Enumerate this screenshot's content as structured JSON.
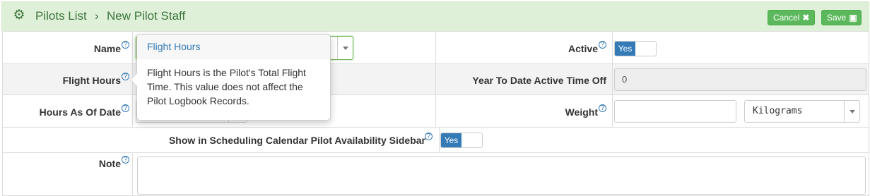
{
  "header": {
    "breadcrumb_link": "Pilots List",
    "separator": "›",
    "current": "New Pilot Staff",
    "cancel_label": "Cancel",
    "save_label": "Save",
    "icons": {
      "header": "gear-icon",
      "cancel": "close-icon",
      "save": "floppy-disk-icon"
    },
    "background_color": "#dff0d8",
    "text_color": "#3c763d"
  },
  "form": {
    "name": {
      "label": "Name",
      "value": ""
    },
    "active": {
      "label": "Active",
      "value": "Yes"
    },
    "flight_hours": {
      "label": "Flight Hours"
    },
    "ytd_time_off": {
      "label": "Year To Date Active Time Off",
      "value": "0"
    },
    "hours_as_of_date": {
      "label": "Hours As Of Date"
    },
    "weight": {
      "label": "Weight",
      "value": "",
      "unit": "Kilograms"
    },
    "show_in_calendar": {
      "label": "Show in Scheduling Calendar Pilot Availability Sidebar",
      "value": "Yes"
    },
    "note": {
      "label": "Note",
      "value": ""
    },
    "help_glyph": "?"
  },
  "popover": {
    "title": "Flight Hours",
    "body": "Flight Hours is the Pilot's Total Flight Time. This value does not affect the Pilot Logbook Records."
  },
  "colors": {
    "toggle_on": "#337ab7",
    "primary_button": "#5cb85c"
  }
}
